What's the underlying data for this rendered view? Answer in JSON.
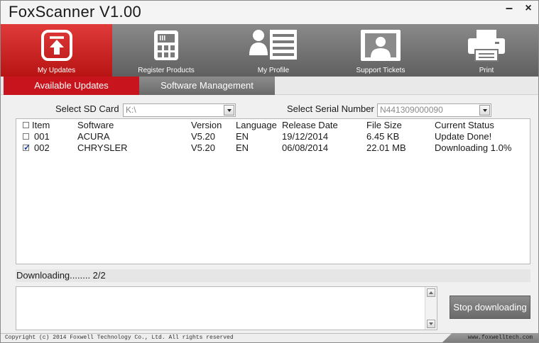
{
  "app": {
    "title": "FoxScanner  V1.00"
  },
  "window": {
    "minimize_glyph": "–",
    "close_glyph": "×"
  },
  "toolbar": {
    "items": [
      {
        "label": "My Updates",
        "icon": "upload-arrow-icon",
        "active": true
      },
      {
        "label": "Register Products",
        "icon": "calculator-icon",
        "active": false
      },
      {
        "label": "My Profile",
        "icon": "profile-card-icon",
        "active": false
      },
      {
        "label": "Support Tickets",
        "icon": "support-person-icon",
        "active": false
      },
      {
        "label": "Print",
        "icon": "printer-icon",
        "active": false
      }
    ]
  },
  "tabs": [
    {
      "label": "Available Updates",
      "active": true
    },
    {
      "label": "Software Management",
      "active": false
    }
  ],
  "sd_card": {
    "label": "Select SD Card",
    "value": "K:\\"
  },
  "serial": {
    "label": "Select Serial Number",
    "value": "N441309000090"
  },
  "table": {
    "columns": [
      "Item",
      "Software",
      "Version",
      "Language",
      "Release Date",
      "File Size",
      "Current Status"
    ],
    "rows": [
      {
        "checked": false,
        "item": "001",
        "software": "ACURA",
        "version": "V5.20",
        "language": "EN",
        "release_date": "19/12/2014",
        "file_size": "6.45 KB",
        "status": "Update Done!"
      },
      {
        "checked": true,
        "item": "002",
        "software": "CHRYSLER",
        "version": "V5.20",
        "language": "EN",
        "release_date": "06/08/2014",
        "file_size": "22.01 MB",
        "status": "Downloading 1.0%"
      }
    ]
  },
  "status": {
    "text": "Downloading........  2/2"
  },
  "actions": {
    "stop_label": "Stop downloading"
  },
  "footer": {
    "copyright": "Copyright (c) 2014 Foxwell Technology Co., Ltd. All rights reserved",
    "url": "www.foxwelltech.com"
  },
  "colors": {
    "accent_red": "#c8141c",
    "toolbar_gray": "#6f6f6f",
    "check_blue": "#1a3fa0"
  }
}
